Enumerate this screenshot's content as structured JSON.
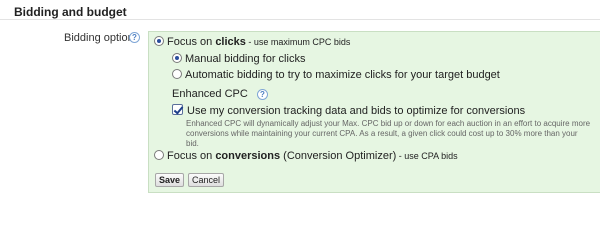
{
  "section": {
    "title": "Bidding and budget"
  },
  "bidding_option": {
    "label": "Bidding option",
    "help_glyph": "?",
    "focus_clicks": {
      "prefix": "Focus on ",
      "emphasis": "clicks",
      "suffix": " - use maximum CPC bids",
      "selected": true
    },
    "manual": {
      "label": "Manual bidding for clicks",
      "selected": true
    },
    "automatic": {
      "label": "Automatic bidding to try to maximize clicks for your target budget",
      "selected": false
    },
    "enhanced_cpc": {
      "heading": "Enhanced CPC",
      "checkbox_label": "Use my conversion tracking data and bids to optimize for conversions",
      "checked": true,
      "help_text": "Enhanced CPC will dynamically adjust your Max. CPC bid up or down for each auction in an effort to acquire more conversions while maintaining your current CPA. As a result, a given click could cost up to 30% more than your bid."
    },
    "focus_conversions": {
      "prefix": "Focus on ",
      "emphasis": "conversions",
      "middle": " (Conversion Optimizer)",
      "suffix": " - use CPA bids",
      "selected": false
    }
  },
  "buttons": {
    "save": "Save",
    "cancel": "Cancel"
  },
  "icons": {
    "help": "help-icon",
    "radio": "radio-icon",
    "checkbox": "checkbox-icon"
  },
  "colors": {
    "panel_bg": "#e6f6e2",
    "radio_fill": "#2b4e9c",
    "help_blue": "#4d7fc2"
  }
}
